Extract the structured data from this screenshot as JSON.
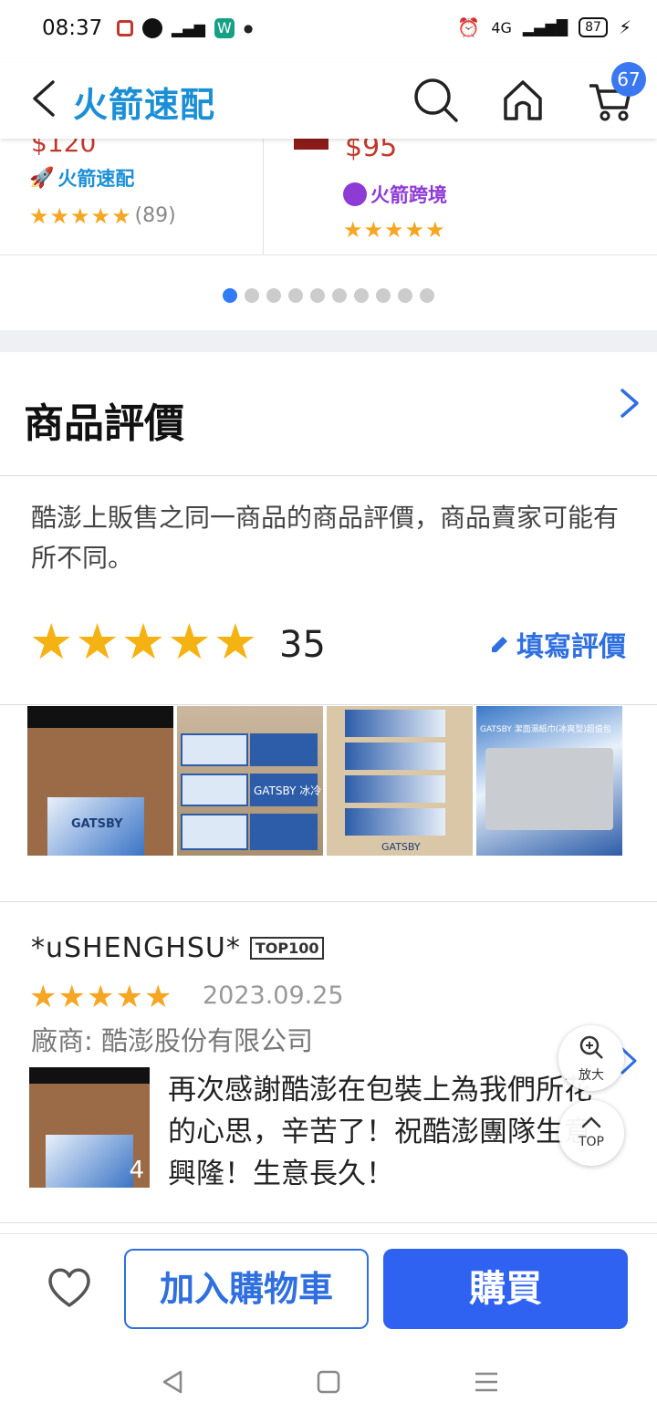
{
  "status_bar": {
    "time": "08:37",
    "signal": "4G",
    "battery": "87"
  },
  "header": {
    "brand": "火箭速配",
    "cart_count": "67"
  },
  "carousel": {
    "left": {
      "tag": "火箭速配",
      "review_count": "(89)"
    },
    "right": {
      "price": "$95",
      "tag": "火箭跨境"
    },
    "dots_total": 10,
    "active_dot": 1
  },
  "reviews": {
    "title": "商品評價",
    "note": "酷澎上販售之同一商品的商品評價，商品賣家可能有所不同。",
    "rating_stars": 5,
    "count": "35",
    "write_label": "填寫評價",
    "photo_labels": [
      "GATSBY",
      "GATSBY 冰冷",
      "GATSBY",
      "GATSBY 潔面濕紙巾(冰爽型)超值包"
    ]
  },
  "review": {
    "author": "*uSHENGHSU*",
    "badge": "TOP100",
    "stars": 5,
    "date": "2023.09.25",
    "vendor": "廠商: 酷澎股份有限公司",
    "photo_count": "4",
    "text": "再次感謝酷澎在包裝上為我們所花的心思，辛苦了！祝酷澎團隊生意興隆！生意長久！"
  },
  "floating": {
    "zoom_label": "放大",
    "top_label": "TOP"
  },
  "bottom_bar": {
    "add_to_cart": "加入購物車",
    "buy": "購買"
  },
  "colors": {
    "brand_blue": "#1b8fd6",
    "action_blue": "#2f62f0",
    "star": "#f5a623",
    "cross_border": "#8e3bd6"
  }
}
